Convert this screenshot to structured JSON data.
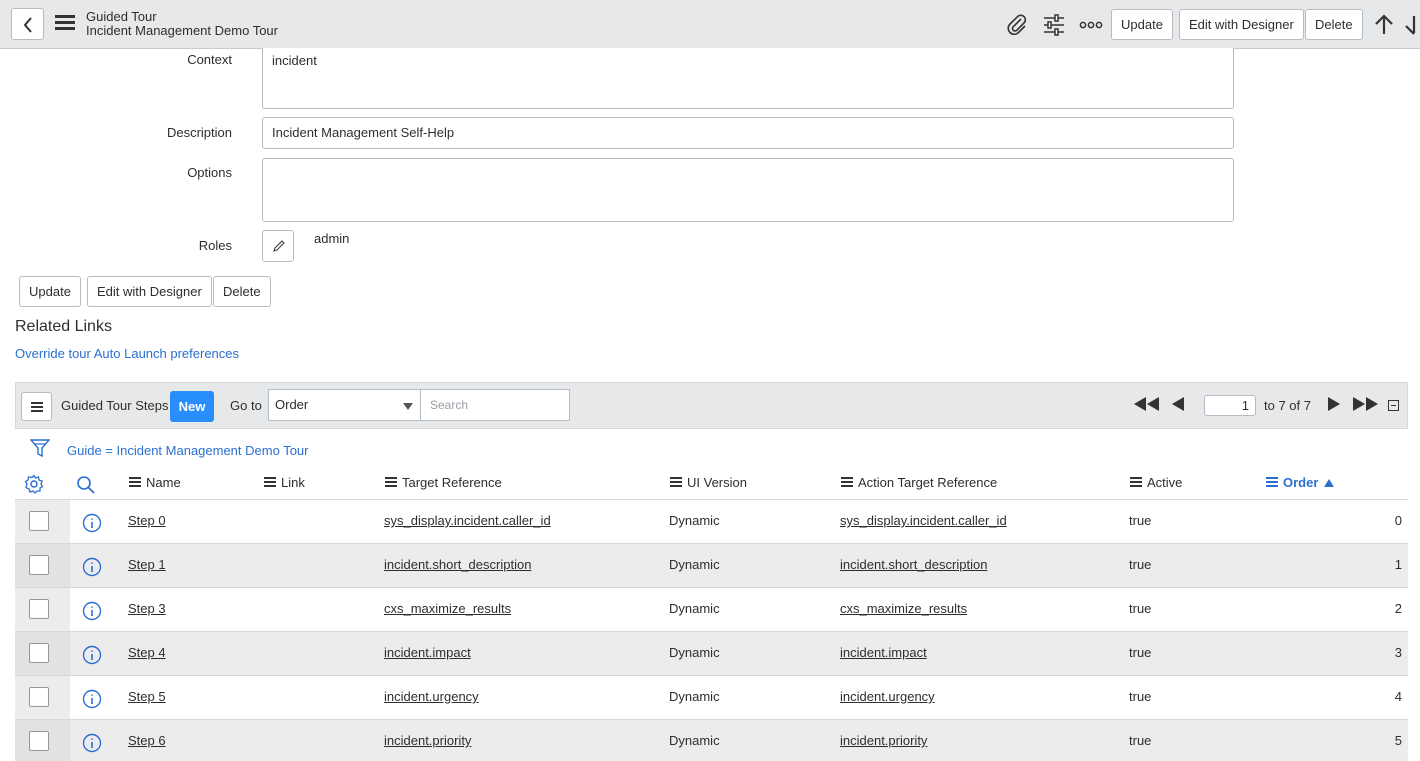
{
  "header": {
    "record_type": "Guided Tour",
    "record_name": "Incident Management Demo Tour",
    "update_label": "Update",
    "designer_label": "Edit with Designer",
    "delete_label": "Delete"
  },
  "form": {
    "context_label": "Context",
    "context_value": "incident",
    "description_label": "Description",
    "description_value": "Incident Management Self-Help",
    "options_label": "Options",
    "options_value": "",
    "roles_label": "Roles",
    "roles_value": "admin",
    "update_label": "Update",
    "designer_label": "Edit with Designer",
    "delete_label": "Delete"
  },
  "related_links": {
    "title": "Related Links",
    "link": "Override tour Auto Launch preferences"
  },
  "list": {
    "title": "Guided Tour Steps",
    "new_label": "New",
    "goto_label": "Go to",
    "goto_selected": "Order",
    "search_placeholder": "Search",
    "page_value": "1",
    "page_range": "to 7 of 7",
    "filter_text": "Guide = Incident Management Demo Tour",
    "columns": [
      "Name",
      "Link",
      "Target Reference",
      "UI Version",
      "Action Target Reference",
      "Active",
      "Order"
    ],
    "rows": [
      {
        "name": "Step 0",
        "link": "",
        "target": "sys_display.incident.caller_id",
        "ui_version": "Dynamic",
        "action_target": "sys_display.incident.caller_id",
        "active": "true",
        "order": "0"
      },
      {
        "name": "Step 1",
        "link": "",
        "target": "incident.short_description",
        "ui_version": "Dynamic",
        "action_target": "incident.short_description",
        "active": "true",
        "order": "1"
      },
      {
        "name": "Step 3",
        "link": "",
        "target": "cxs_maximize_results",
        "ui_version": "Dynamic",
        "action_target": "cxs_maximize_results",
        "active": "true",
        "order": "2"
      },
      {
        "name": "Step 4",
        "link": "",
        "target": "incident.impact",
        "ui_version": "Dynamic",
        "action_target": "incident.impact",
        "active": "true",
        "order": "3"
      },
      {
        "name": "Step 5",
        "link": "",
        "target": "incident.urgency",
        "ui_version": "Dynamic",
        "action_target": "incident.urgency",
        "active": "true",
        "order": "4"
      },
      {
        "name": "Step 6",
        "link": "",
        "target": "incident.priority",
        "ui_version": "Dynamic",
        "action_target": "incident.priority",
        "active": "true",
        "order": "5"
      }
    ]
  },
  "colors": {
    "accent": "#278efc",
    "link": "#2b6fd1",
    "header_bg": "#e6e8ea"
  }
}
